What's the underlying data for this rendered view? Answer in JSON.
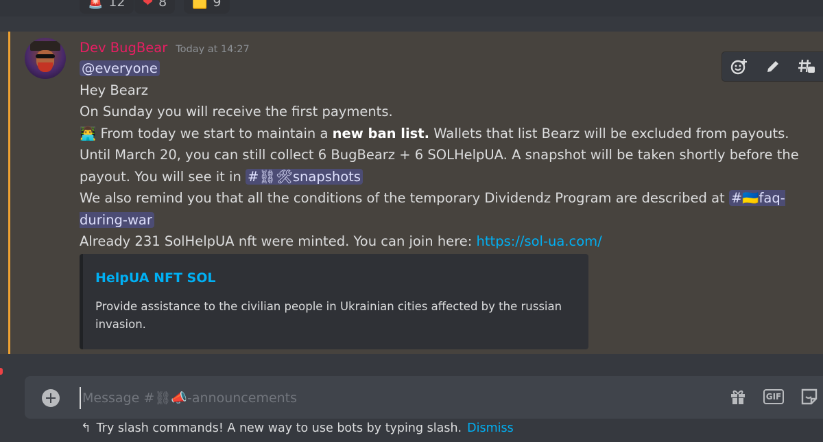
{
  "reactions": [
    {
      "icon": "red-stripes-emoji",
      "emoji": "🚨",
      "count": "12"
    },
    {
      "icon": "heart-emoji",
      "emoji": "❤",
      "count": "8"
    },
    {
      "icon": "yellow-flag-emoji",
      "emoji": "🟨",
      "count": "9"
    }
  ],
  "message": {
    "author": "Dev BugBear",
    "author_color": "#e91e63",
    "timestamp": "Today at 14:27",
    "mention_everyone": "@everyone",
    "line_greeting": "Hey Bearz",
    "line_payments": "On Sunday you will receive the first payments.",
    "ban_emoji": "👨‍💻",
    "ban_prefix": " From today we start to maintain a ",
    "ban_bold": "new ban list.",
    "ban_suffix": " Wallets that list Bearz will be excluded from payouts.",
    "snapshot_text": "Until March 20, you can still collect 6 BugBearz + 6 SOLHelpUA. A snapshot will be taken shortly before the payout. You will see it in ",
    "channel_snapshots": "#⛓🛠snapshots",
    "remind_text": "We also remind you that all the conditions of the temporary Dividendz Program are described at ",
    "channel_faq": "#🇺🇦faq-during-war",
    "minted_text": "Already 231 SolHelpUA nft were minted. You can join here: ",
    "link": "https://sol-ua.com/",
    "highlight_bar_color": "#f0a232"
  },
  "embed": {
    "title": "HelpUA NFT SOL",
    "description": "Provide assistance to the civilian people in Ukrainian cities affected by the russian invasion."
  },
  "hover_actions": [
    "add-reaction-icon",
    "edit-icon",
    "create-thread-icon"
  ],
  "composer": {
    "placeholder": "Message #⛓📣-announcements",
    "icons": [
      "gift-icon",
      "gif-button",
      "sticker-icon"
    ],
    "gif_label": "GIF"
  },
  "hint": {
    "text": "Try slash commands! A new way to use bots by typing slash.",
    "dismiss": "Dismiss"
  }
}
